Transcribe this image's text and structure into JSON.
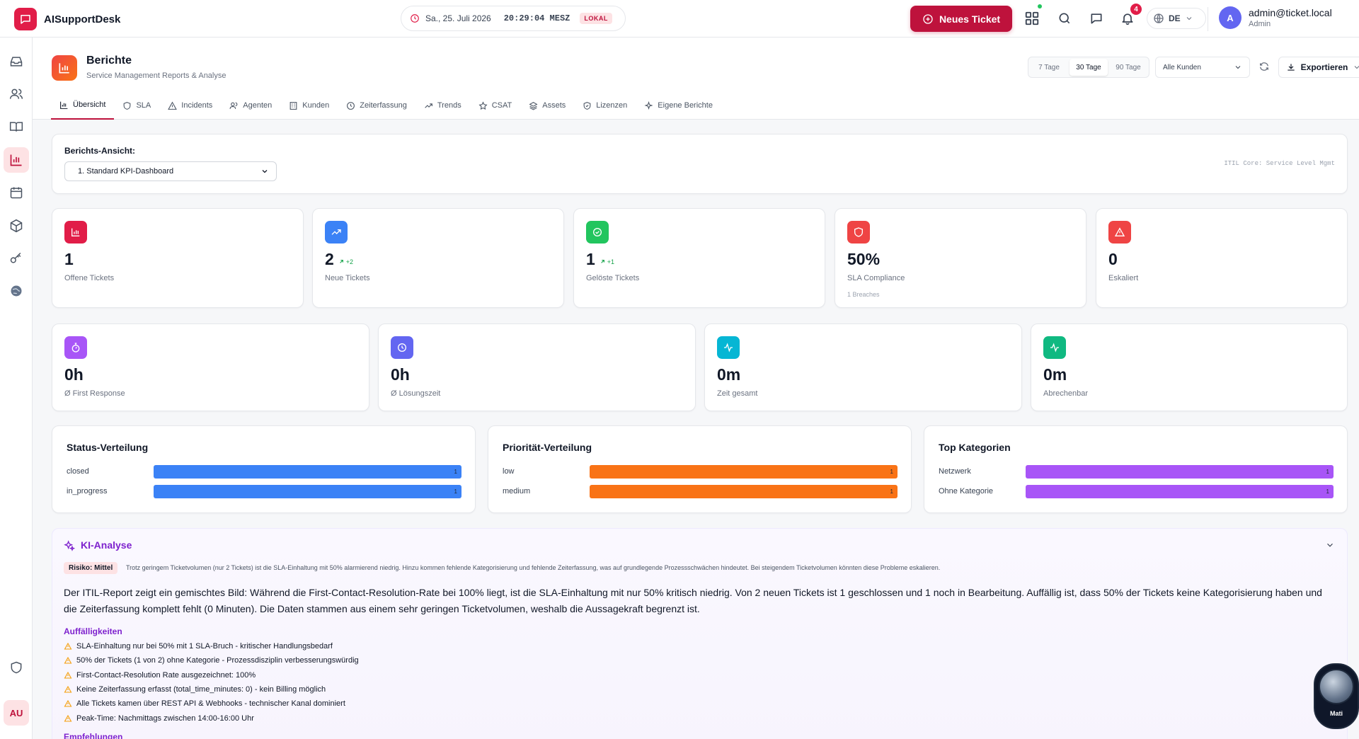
{
  "app": {
    "name": "AISupportDesk"
  },
  "header": {
    "date": "Sa., 25. Juli 2026",
    "time": "20:29:04 MESZ",
    "timezone_badge": "LOKAL",
    "new_ticket_label": "Neues Ticket",
    "notification_count": "4",
    "language": "DE",
    "user_email": "admin@ticket.local",
    "user_role": "Admin",
    "user_initial": "A"
  },
  "sidebar": {
    "items": [
      "inbox-icon",
      "users-icon",
      "book-icon",
      "reports-icon",
      "calendar-icon",
      "package-icon",
      "key-icon",
      "globe-icon"
    ],
    "active": "reports-icon",
    "bottom_icon": "shield-icon",
    "user_initials": "AU"
  },
  "page": {
    "title": "Berichte",
    "subtitle": "Service Management Reports & Analyse",
    "ranges": [
      "7 Tage",
      "30 Tage",
      "90 Tage"
    ],
    "active_range": "30 Tage",
    "customer_filter": "Alle Kunden",
    "export_label": "Exportieren",
    "tabs": [
      {
        "label": "Übersicht",
        "icon": "bar-chart-icon",
        "active": true
      },
      {
        "label": "SLA",
        "icon": "shield-icon"
      },
      {
        "label": "Incidents",
        "icon": "alert-triangle-icon"
      },
      {
        "label": "Agenten",
        "icon": "users-icon"
      },
      {
        "label": "Kunden",
        "icon": "building-icon"
      },
      {
        "label": "Zeiterfassung",
        "icon": "clock-icon"
      },
      {
        "label": "Trends",
        "icon": "trend-icon"
      },
      {
        "label": "CSAT",
        "icon": "star-icon"
      },
      {
        "label": "Assets",
        "icon": "layers-icon"
      },
      {
        "label": "Lizenzen",
        "icon": "badge-icon"
      },
      {
        "label": "Eigene Berichte",
        "icon": "sparkle-icon"
      }
    ]
  },
  "report_view": {
    "label": "Berichts-Ansicht:",
    "selected": "1. Standard KPI-Dashboard",
    "note": "ITIL Core: Service Level Mgmt"
  },
  "kpis_row1": [
    {
      "value": "1",
      "label": "Offene Tickets",
      "color": "#e11d48",
      "icon": "bar-chart-icon"
    },
    {
      "value": "2",
      "trend": "+2",
      "label": "Neue Tickets",
      "color": "#3b82f6",
      "icon": "trend-icon"
    },
    {
      "value": "1",
      "trend": "+1",
      "label": "Gelöste Tickets",
      "color": "#22c55e",
      "icon": "check-circle-icon"
    },
    {
      "value": "50%",
      "label": "SLA Compliance",
      "sub": "1 Breaches",
      "color": "#ef4444",
      "icon": "shield-icon"
    },
    {
      "value": "0",
      "label": "Eskaliert",
      "color": "#ef4444",
      "icon": "alert-triangle-icon"
    }
  ],
  "kpis_row2": [
    {
      "value": "0h",
      "label": "Ø First Response",
      "color": "#a855f7",
      "icon": "stopwatch-icon"
    },
    {
      "value": "0h",
      "label": "Ø Lösungszeit",
      "color": "#6366f1",
      "icon": "clock-icon"
    },
    {
      "value": "0m",
      "label": "Zeit gesamt",
      "color": "#06b6d4",
      "icon": "activity-icon"
    },
    {
      "value": "0m",
      "label": "Abrechenbar",
      "color": "#10b981",
      "icon": "activity-icon"
    }
  ],
  "distributions": [
    {
      "title": "Status-Verteilung",
      "color": "#3b82f6",
      "rows": [
        {
          "label": "closed",
          "value": 1
        },
        {
          "label": "in_progress",
          "value": 1
        }
      ]
    },
    {
      "title": "Priorität-Verteilung",
      "color": "#f97316",
      "rows": [
        {
          "label": "low",
          "value": 1
        },
        {
          "label": "medium",
          "value": 1
        }
      ]
    },
    {
      "title": "Top Kategorien",
      "color": "#a855f7",
      "rows": [
        {
          "label": "Netzwerk",
          "value": 1
        },
        {
          "label": "Ohne Kategorie",
          "value": 1
        }
      ]
    }
  ],
  "ki": {
    "title": "KI-Analyse",
    "risk": "Risiko: Mittel",
    "risk_text": "Trotz geringem Ticketvolumen (nur 2 Tickets) ist die SLA-Einhaltung mit 50% alarmierend niedrig. Hinzu kommen fehlende Kategorisierung und fehlende Zeiterfassung, was auf grundlegende Prozessschwächen hindeutet. Bei steigendem Ticketvolumen könnten diese Probleme eskalieren.",
    "summary": "Der ITIL-Report zeigt ein gemischtes Bild: Während die First-Contact-Resolution-Rate bei 100% liegt, ist die SLA-Einhaltung mit nur 50% kritisch niedrig. Von 2 neuen Tickets ist 1 geschlossen und 1 noch in Bearbeitung. Auffällig ist, dass 50% der Tickets keine Kategorisierung haben und die Zeiterfassung komplett fehlt (0 Minuten). Die Daten stammen aus einem sehr geringen Ticketvolumen, weshalb die Aussagekraft begrenzt ist.",
    "findings_title": "Auffälligkeiten",
    "findings": [
      "SLA-Einhaltung nur bei 50% mit 1 SLA-Bruch - kritischer Handlungsbedarf",
      "50% der Tickets (1 von 2) ohne Kategorie - Prozessdisziplin verbesserungswürdig",
      "First-Contact-Resolution Rate ausgezeichnet: 100%",
      "Keine Zeiterfassung erfasst (total_time_minutes: 0) - kein Billing möglich",
      "Alle Tickets kamen über REST API & Webhooks - technischer Kanal dominiert",
      "Peak-Time: Nachmittags zwischen 14:00-16:00 Uhr"
    ],
    "recommendations_title": "Empfehlungen"
  },
  "assistant": {
    "name": "Mati"
  }
}
